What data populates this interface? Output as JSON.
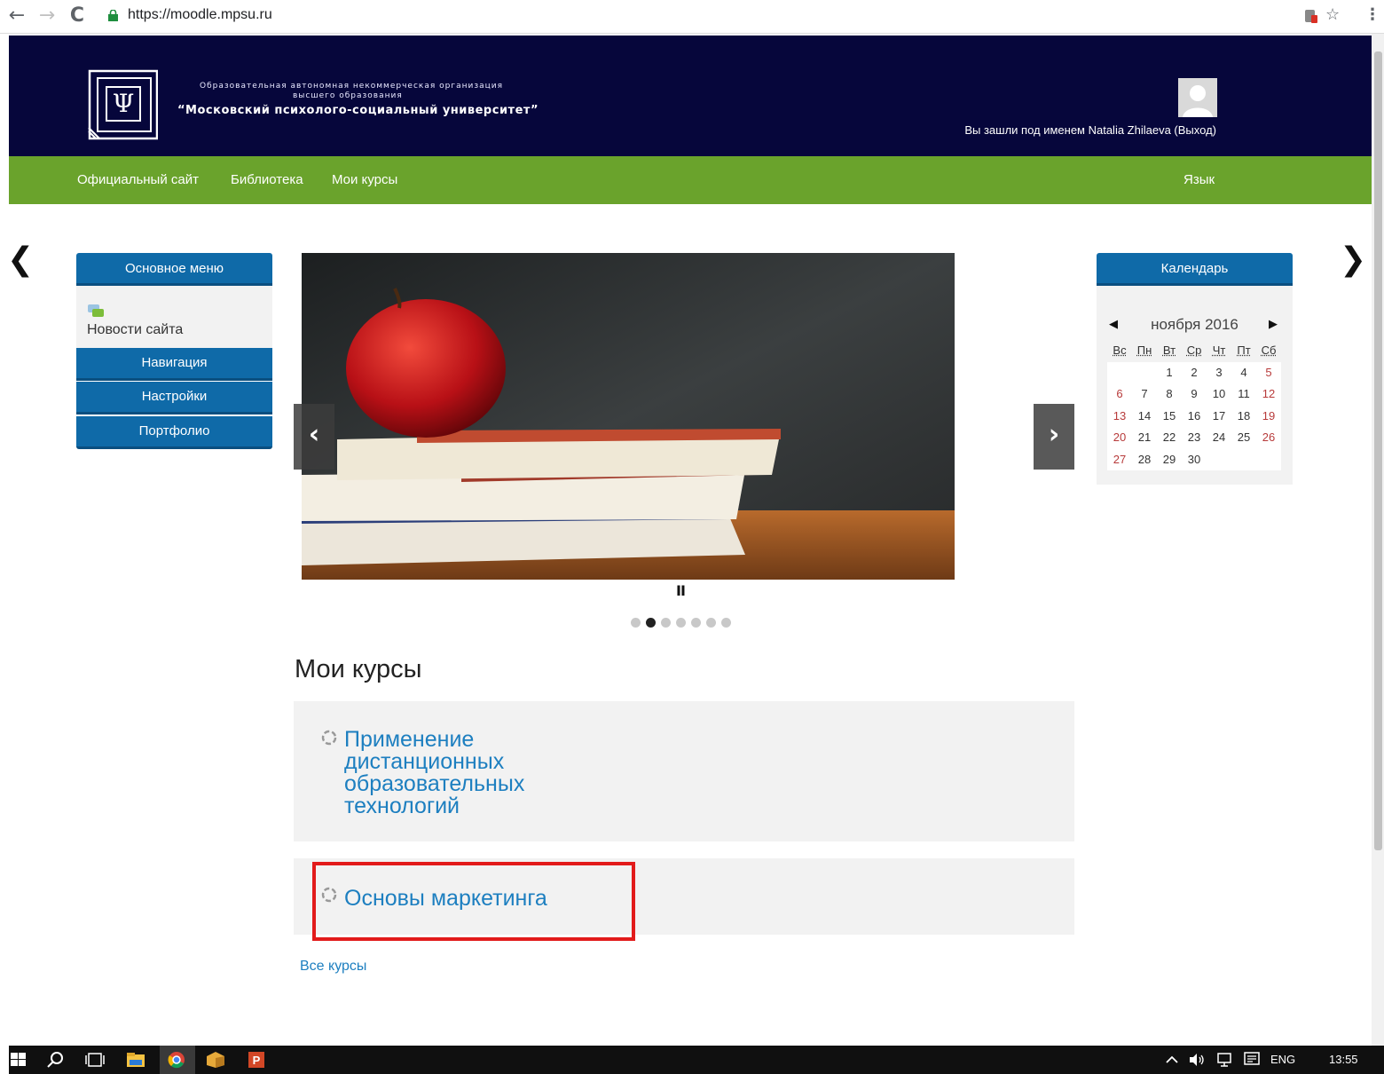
{
  "browser": {
    "url": "https://moodle.mpsu.ru",
    "back_icon": "←",
    "forward_icon": "→",
    "reload_icon": "C",
    "star_icon": "☆",
    "menu_icon": "⋮"
  },
  "header": {
    "org_line1": "Образовательная автономная некоммерческая организация",
    "org_line2": "высшего образования",
    "org_name": "“Московский психолого-социальный университет”",
    "user_line": "Вы зашли под именем Natalia Zhilaeva (Выход)"
  },
  "nav": {
    "items": [
      "Официальный сайт",
      "Библиотека",
      "Мои курсы"
    ],
    "language": "Язык"
  },
  "page_arrows": {
    "left": "❮",
    "right": "❯"
  },
  "main_menu": {
    "title": "Основное меню",
    "news_link": "Новости сайта",
    "buttons": [
      "Навигация",
      "Настройки",
      "Портфолио"
    ]
  },
  "slider": {
    "prev": "‹",
    "next": "›",
    "pause": "II",
    "dot_count": 7,
    "active_dot": 2
  },
  "courses": {
    "title": "Мои курсы",
    "items": [
      {
        "lines": [
          "Применение",
          "дистанционных",
          "образовательных",
          "технологий"
        ]
      },
      {
        "lines": [
          "Основы маркетинга"
        ]
      }
    ],
    "all_courses": "Все курсы"
  },
  "calendar": {
    "title": "Календарь",
    "month": "ноября 2016",
    "prev": "◀",
    "next": "▶",
    "weekdays": [
      "Вс",
      "Пн",
      "Вт",
      "Ср",
      "Чт",
      "Пт",
      "Сб"
    ],
    "weeks": [
      [
        "",
        "",
        "1",
        "2",
        "3",
        "4",
        "5"
      ],
      [
        "6",
        "7",
        "8",
        "9",
        "10",
        "11",
        "12"
      ],
      [
        "13",
        "14",
        "15",
        "16",
        "17",
        "18",
        "19"
      ],
      [
        "20",
        "21",
        "22",
        "23",
        "24",
        "25",
        "26"
      ],
      [
        "27",
        "28",
        "29",
        "30",
        "",
        "",
        ""
      ]
    ]
  },
  "taskbar": {
    "language": "ENG",
    "time": "13:55"
  },
  "colors": {
    "header_bg": "#06063b",
    "nav_green": "#6aa32c",
    "block_blue": "#0f6aa8",
    "link_blue": "#1d7fc0",
    "highlight_red": "#e21b1b",
    "weekend_red": "#b73a3a"
  }
}
